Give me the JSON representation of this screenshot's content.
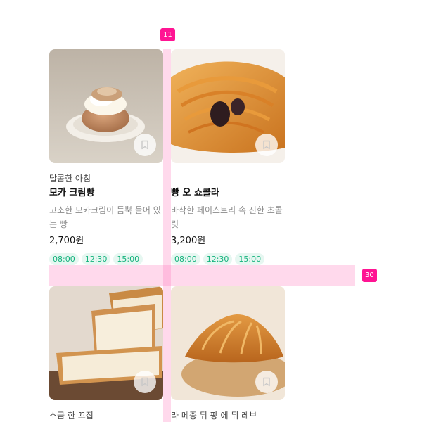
{
  "products": [
    {
      "tagline": "달콤한 아침",
      "name": "모카 크림빵",
      "desc1": "고소한 모카크림이 듬뿍 들어 있",
      "desc2": "는 빵",
      "price": "2,700원",
      "times": [
        "08:00",
        "12:30",
        "15:00"
      ],
      "image_icon": "cream-bun-photo"
    },
    {
      "tagline": "",
      "name": "빵 오 쇼콜라",
      "desc1": "바삭한 페이스트리 속 진한 초콜",
      "desc2": "릿",
      "price": "3,200원",
      "times": [
        "08:00",
        "12:30",
        "15:00"
      ],
      "image_icon": "pain-au-chocolat-photo"
    },
    {
      "tagline": "소금 한 꼬집",
      "image_icon": "bread-loaf-photo"
    },
    {
      "tagline": "라 메종 뒤 팡 에 뒤 레브",
      "image_icon": "croissant-photo"
    }
  ],
  "spacing": {
    "column_gap_label": "11",
    "row_gap_label": "30"
  },
  "colors": {
    "accent_green": "#13b27c",
    "chip_bg": "#e6f7f1",
    "spacing_badge": "#ff1493"
  }
}
